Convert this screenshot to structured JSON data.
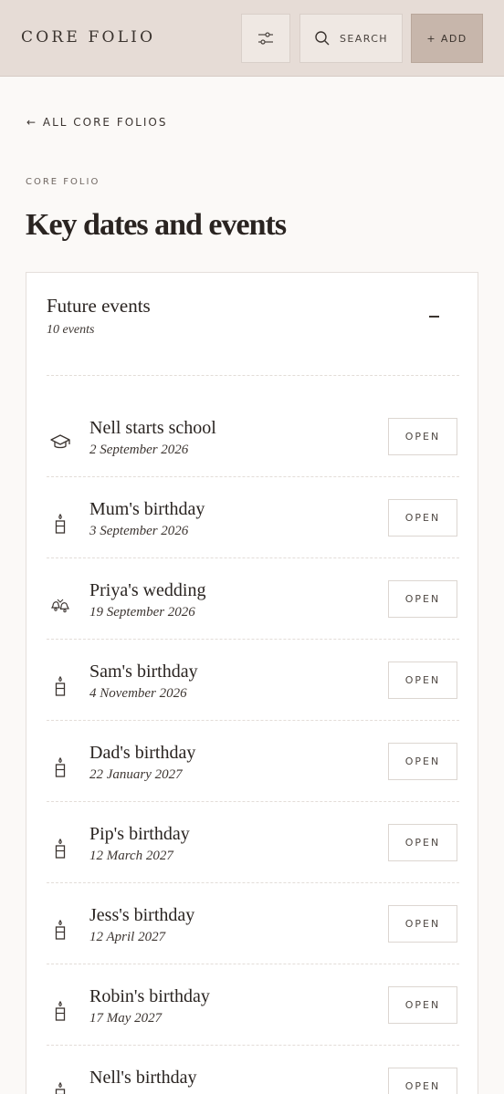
{
  "header": {
    "brand": "CORE FOLIO",
    "filter_icon": "sliders-icon",
    "search_label": "SEARCH",
    "add_label": "+ ADD"
  },
  "nav": {
    "back_label": "← ALL CORE FOLIOS"
  },
  "page": {
    "eyebrow": "CORE FOLIO",
    "title": "Key dates and events"
  },
  "section": {
    "title": "Future events",
    "count_label": "10 events",
    "collapse_icon": "minus-icon"
  },
  "events": [
    {
      "name": "Nell starts school",
      "date": "2 September 2026",
      "icon": "graduation-cap-icon",
      "action": "OPEN"
    },
    {
      "name": "Mum's birthday",
      "date": "3 September 2026",
      "icon": "candle-icon",
      "action": "OPEN"
    },
    {
      "name": "Priya's wedding",
      "date": "19 September 2026",
      "icon": "wedding-bells-icon",
      "action": "OPEN"
    },
    {
      "name": "Sam's birthday",
      "date": "4 November 2026",
      "icon": "candle-icon",
      "action": "OPEN"
    },
    {
      "name": "Dad's birthday",
      "date": "22 January 2027",
      "icon": "candle-icon",
      "action": "OPEN"
    },
    {
      "name": "Pip's birthday",
      "date": "12 March 2027",
      "icon": "candle-icon",
      "action": "OPEN"
    },
    {
      "name": "Jess's birthday",
      "date": "12 April 2027",
      "icon": "candle-icon",
      "action": "OPEN"
    },
    {
      "name": "Robin's birthday",
      "date": "17 May 2027",
      "icon": "candle-icon",
      "action": "OPEN"
    },
    {
      "name": "Nell's birthday",
      "date": "",
      "icon": "candle-icon",
      "action": "OPEN"
    }
  ],
  "colors": {
    "header_bg": "#e6dcd6",
    "add_button_bg": "#c7b6ab",
    "page_bg": "#fbf9f7",
    "text": "#2a2421"
  }
}
